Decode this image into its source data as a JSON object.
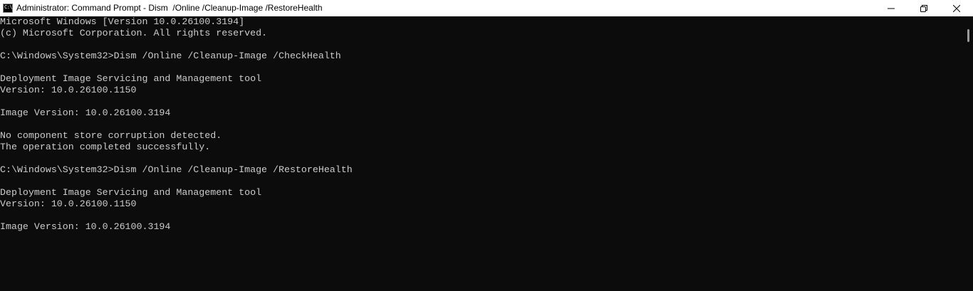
{
  "window": {
    "title": "Administrator: Command Prompt - Dism  /Online /Cleanup-Image /RestoreHealth",
    "icon_label": "C:\\"
  },
  "console": {
    "lines": [
      "Microsoft Windows [Version 10.0.26100.3194]",
      "(c) Microsoft Corporation. All rights reserved.",
      "",
      "C:\\Windows\\System32>Dism /Online /Cleanup-Image /CheckHealth",
      "",
      "Deployment Image Servicing and Management tool",
      "Version: 10.0.26100.1150",
      "",
      "Image Version: 10.0.26100.3194",
      "",
      "No component store corruption detected.",
      "The operation completed successfully.",
      "",
      "C:\\Windows\\System32>Dism /Online /Cleanup-Image /RestoreHealth",
      "",
      "Deployment Image Servicing and Management tool",
      "Version: 10.0.26100.1150",
      "",
      "Image Version: 10.0.26100.3194"
    ]
  },
  "colors": {
    "console_bg": "#0c0c0c",
    "console_fg": "#cccccc",
    "titlebar_bg": "#ffffff"
  },
  "icons": {
    "minimize": "minimize-icon",
    "maximize": "restore-icon",
    "close": "close-icon"
  }
}
